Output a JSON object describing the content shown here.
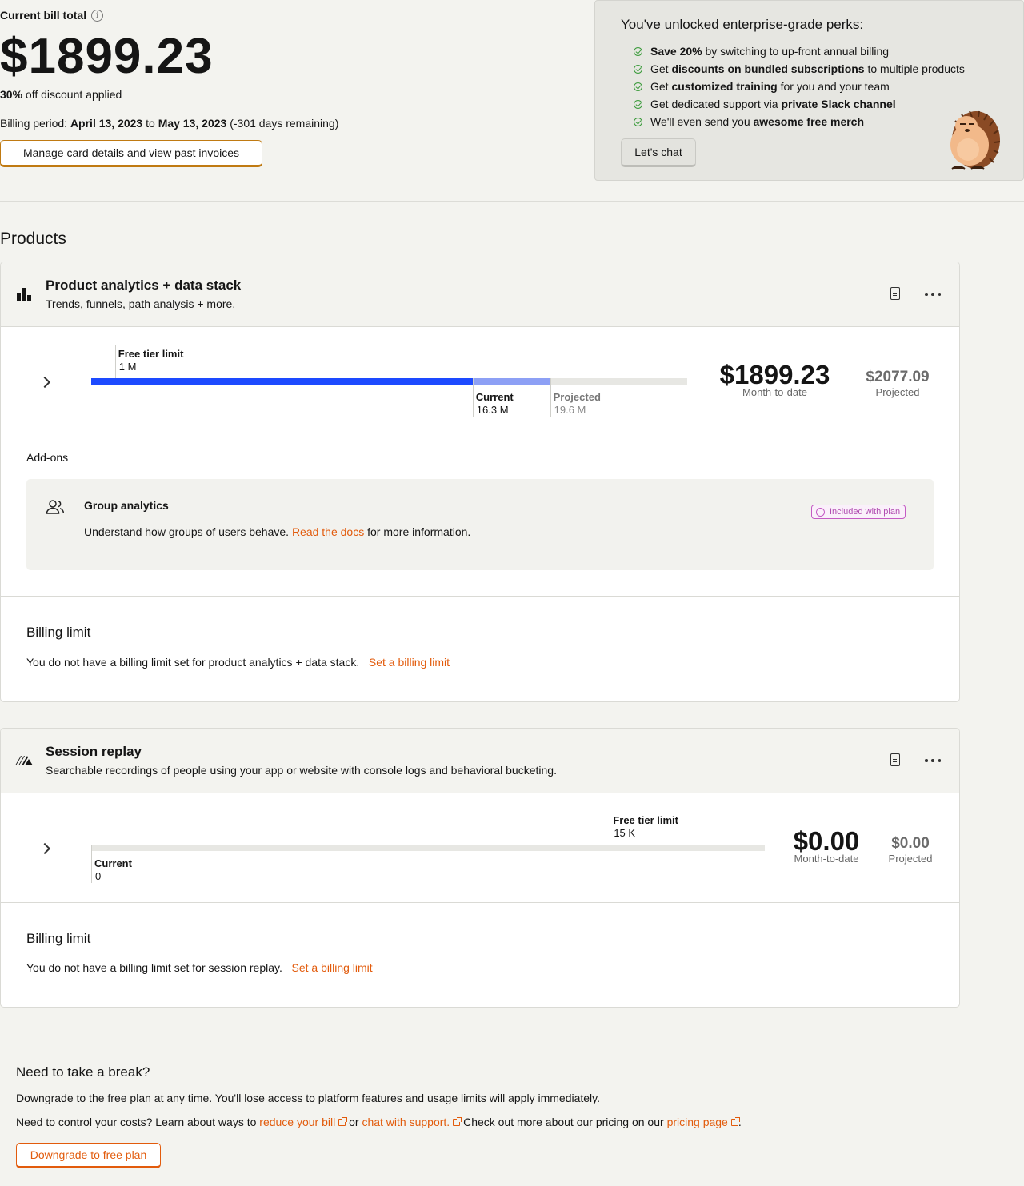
{
  "header": {
    "label": "Current bill total",
    "amount": "$1899.23",
    "discount_pct": "30%",
    "discount_text": " off discount applied",
    "period_prefix": "Billing period: ",
    "period_start": "April 13, 2023",
    "period_to": " to ",
    "period_end": "May 13, 2023",
    "period_remaining": " (-301 days remaining)",
    "manage_button": "Manage card details and view past invoices"
  },
  "perks": {
    "title": "You've unlocked enterprise-grade perks:",
    "items": [
      {
        "pre": "",
        "bold": "Save 20%",
        "post": " by switching to up-front annual billing"
      },
      {
        "pre": "Get ",
        "bold": "discounts on bundled subscriptions",
        "post": " to multiple products"
      },
      {
        "pre": "Get ",
        "bold": "customized training",
        "post": " for you and your team"
      },
      {
        "pre": "Get dedicated support via ",
        "bold": "private Slack channel",
        "post": ""
      },
      {
        "pre": "We'll even send you ",
        "bold": "awesome free merch",
        "post": ""
      }
    ],
    "chat_button": "Let's chat"
  },
  "products_title": "Products",
  "products": [
    {
      "icon": "bar-chart-icon",
      "title": "Product analytics + data stack",
      "subtitle": "Trends, funnels, path analysis + more.",
      "free_tier_label": "Free tier limit",
      "free_tier_value": "1 M",
      "current_label": "Current",
      "current_value": "16.3 M",
      "projected_label": "Projected",
      "projected_value": "19.6 M",
      "usage_fraction": {
        "free_tier": 0.04,
        "current": 0.64,
        "projected": 0.77
      },
      "month_to_date": "$1899.23",
      "month_to_date_label": "Month-to-date",
      "projected_cost": "$2077.09",
      "projected_cost_label": "Projected",
      "addons_title": "Add-ons",
      "addon": {
        "title": "Group analytics",
        "desc_pre": "Understand how groups of users behave. ",
        "desc_link": "Read the docs",
        "desc_post": " for more information.",
        "badge": "Included with plan"
      },
      "billing_limit_title": "Billing limit",
      "billing_limit_text": "You do not have a billing limit set for product analytics + data stack.",
      "billing_limit_link": "Set a billing limit"
    },
    {
      "icon": "session-replay-icon",
      "title": "Session replay",
      "subtitle": "Searchable recordings of people using your app or website with console logs and behavioral bucketing.",
      "free_tier_label": "Free tier limit",
      "free_tier_value": "15 K",
      "current_label": "Current",
      "current_value": "0",
      "usage_fraction": {
        "free_tier": 0.77,
        "current": 0.0
      },
      "month_to_date": "$0.00",
      "month_to_date_label": "Month-to-date",
      "projected_cost": "$0.00",
      "projected_cost_label": "Projected",
      "billing_limit_title": "Billing limit",
      "billing_limit_text": "You do not have a billing limit set for session replay.",
      "billing_limit_link": "Set a billing limit"
    }
  ],
  "colors": {
    "accent": "#e25b0c",
    "bar_current": "#1d4aff",
    "bar_projected": "#8da0f5",
    "manage_border": "#c07a12"
  },
  "footer": {
    "title": "Need to take a break?",
    "p1": "Downgrade to the free plan at any time. You'll lose access to platform features and usage limits will apply immediately.",
    "p2_a": "Need to control your costs? Learn about ways to ",
    "link_reduce": "reduce your bill",
    "p2_b": " or ",
    "link_support": "chat with support.",
    "p2_c": " Check out more about our pricing on our ",
    "link_pricing": "pricing page",
    "p2_d": ".",
    "downgrade_button": "Downgrade to free plan"
  }
}
